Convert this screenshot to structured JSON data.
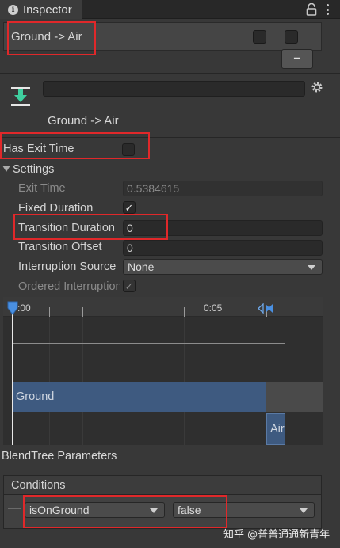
{
  "window": {
    "tab_title": "Inspector"
  },
  "header": {
    "title": "Ground -> Air"
  },
  "transition": {
    "name_value": "",
    "subtitle": "Ground -> Air"
  },
  "has_exit_time": {
    "label": "Has Exit Time",
    "checked": false
  },
  "settings": {
    "label": "Settings",
    "exit_time_label": "Exit Time",
    "exit_time_value": "0.5384615",
    "fixed_duration_label": "Fixed Duration",
    "fixed_duration_checked": true,
    "transition_duration_label": "Transition Duration",
    "transition_duration_value": "0",
    "transition_offset_label": "Transition Offset",
    "transition_offset_value": "0",
    "interruption_source_label": "Interruption Source",
    "interruption_source_value": "None",
    "ordered_interruption_label": "Ordered Interruption",
    "ordered_interruption_checked": true
  },
  "timeline": {
    "label_start": ":00",
    "label_mid": "0:05",
    "from_state": "Ground",
    "to_state": "Air"
  },
  "blend_tree_label": "BlendTree Parameters",
  "conditions": {
    "label": "Conditions",
    "parameter": "isOnGround",
    "value": "false"
  },
  "watermark": "知乎 @普普通通新青年",
  "colors": {
    "highlight_box": "#e0282a",
    "state_bar": "#3e5a80",
    "playhead": "#4a90e2"
  }
}
